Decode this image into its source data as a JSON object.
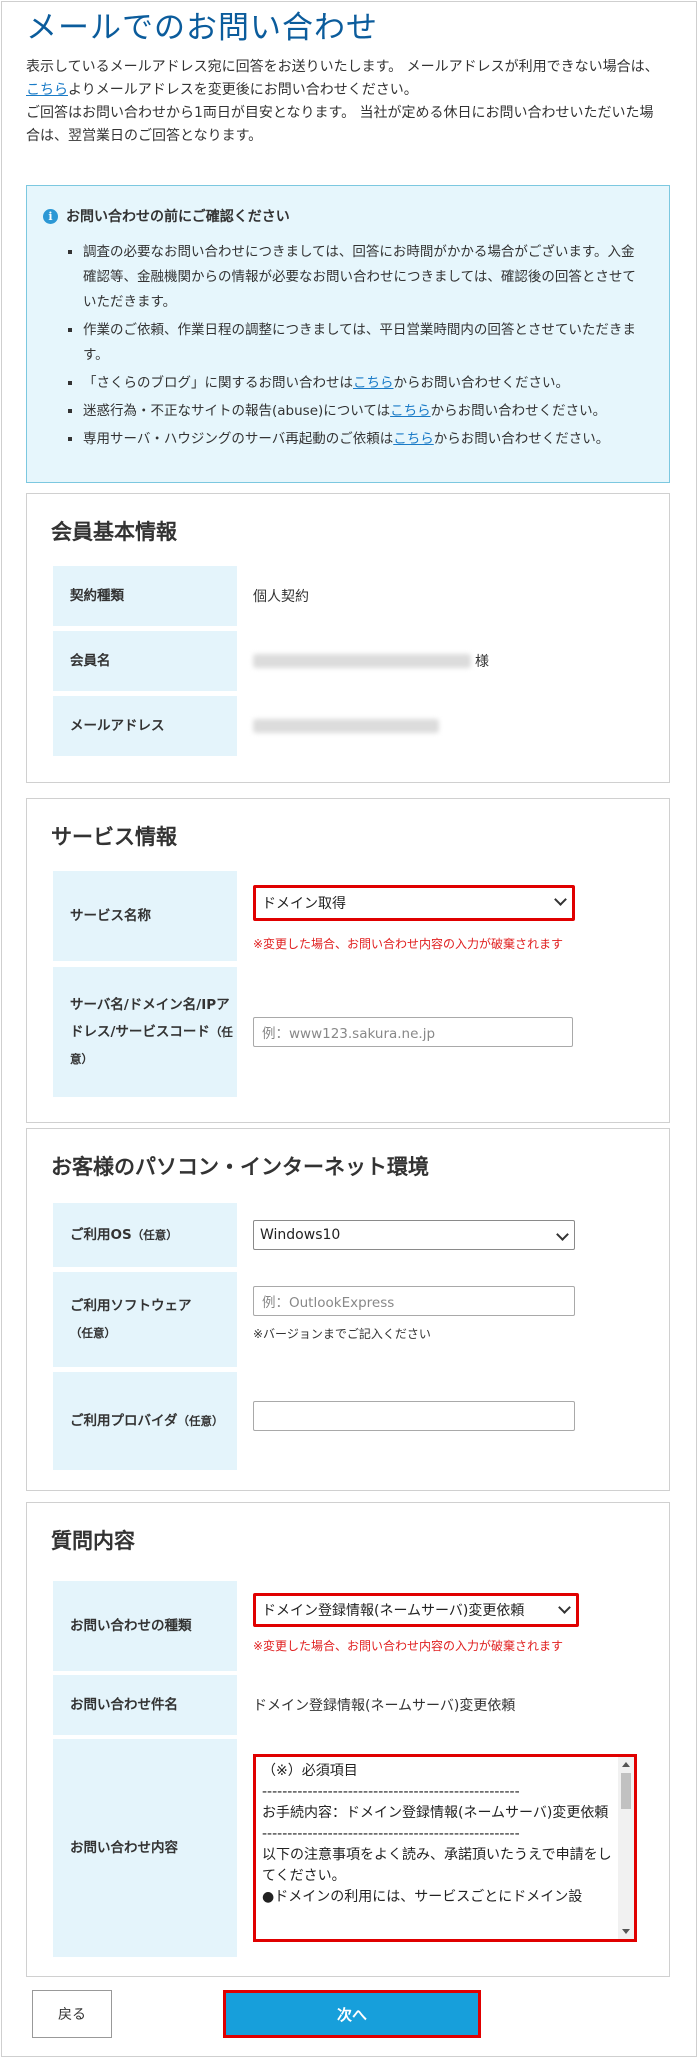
{
  "page_title": "メールでのお問い合わせ",
  "intro": {
    "line1": "表示しているメールアドレス宛に回答をお送りいたします。 メールアドレスが利用できない場合は、",
    "line2_link": "こちら",
    "line2_rest": "よりメールアドレスを変更後にお問い合わせください。",
    "line3": "ご回答はお問い合わせから1両日が目安となります。 当社が定める休日にお問い合わせいただいた場合は、翌営業日のご回答となります。"
  },
  "notice": {
    "icon": "info-icon",
    "title": "お問い合わせの前にご確認ください",
    "items": [
      {
        "text": "調査の必要なお問い合わせにつきましては、回答にお時間がかかる場合がございます。入金確認等、金融機関からの情報が必要なお問い合わせにつきましては、確認後の回答とさせていただきます。"
      },
      {
        "text": "作業のご依頼、作業日程の調整につきましては、平日営業時間内の回答とさせていただきます。"
      },
      {
        "pre": "「さくらのブログ」に関するお問い合わせは",
        "link": "こちら",
        "post": "からお問い合わせください。"
      },
      {
        "pre": "迷惑行為・不正なサイトの報告(abuse)については",
        "link": "こちら",
        "post": "からお問い合わせください。"
      },
      {
        "pre": "専用サーバ・ハウジングのサーバ再起動のご依頼は",
        "link": "こちら",
        "post": "からお問い合わせください。"
      }
    ]
  },
  "member": {
    "heading": "会員基本情報",
    "contract_label": "契約種類",
    "contract_value": "個人契約",
    "name_label": "会員名",
    "name_suffix": "様",
    "email_label": "メールアドレス"
  },
  "service": {
    "heading": "サービス情報",
    "name_label": "サービス名称",
    "name_selected": "ドメイン取得",
    "name_warning": "※変更した場合、お問い合わせ内容の入力が破棄されます",
    "server_label": "サーバ名/ドメイン名/IPアドレス/サービスコード",
    "server_optional": "（任意）",
    "server_placeholder": "例：www123.sakura.ne.jp"
  },
  "environment": {
    "heading": "お客様のパソコン・インターネット環境",
    "os_label": "ご利用OS",
    "os_optional": "（任意）",
    "os_selected": "Windows10",
    "software_label": "ご利用ソフトウェア",
    "software_optional": "（任意）",
    "software_placeholder": "例：OutlookExpress",
    "software_note": "※バージョンまでご記入ください",
    "provider_label": "ご利用プロバイダ",
    "provider_optional": "（任意）",
    "provider_value": ""
  },
  "question": {
    "heading": "質問内容",
    "type_label": "お問い合わせの種類",
    "type_selected": "ドメイン登録情報(ネームサーバ)変更依頼",
    "type_warning": "※変更した場合、お問い合わせ内容の入力が破棄されます",
    "subject_label": "お問い合わせ件名",
    "subject_value": "ドメイン登録情報(ネームサーバ)変更依頼",
    "content_label": "お問い合わせ内容",
    "content_lines": [
      "（※）必須項目",
      "---------------------------------------------------",
      "お手続内容：ドメイン登録情報(ネームサーバ)変更依頼",
      "---------------------------------------------------",
      "以下の注意事項をよく読み、承諾頂いたうえで申請をしてください。",
      "●ドメインの利用には、サービスごとにドメイン設"
    ]
  },
  "buttons": {
    "back": "戻る",
    "next": "次へ"
  },
  "colors": {
    "title": "#0b5c9c",
    "link": "#1a7bc7",
    "notice_bg": "#e6f6fc",
    "label_bg": "#e4f4fb",
    "highlight": "#e00000",
    "primary_button": "#179fdb"
  }
}
